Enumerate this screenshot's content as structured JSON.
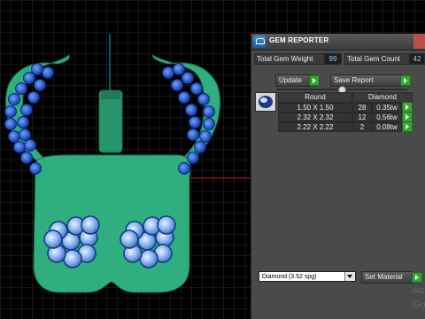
{
  "panel": {
    "title": "GEM REPORTER",
    "total_gem_weight_label": "Total Gem Weight",
    "total_gem_weight_value": "99",
    "total_gem_count_label": "Total Gem Count",
    "total_gem_count_value": "42",
    "update_label": "Update",
    "save_report_label": "Save Report",
    "table": {
      "headers": [
        "Round",
        "Diamond"
      ],
      "rows": [
        {
          "size": "1.50 X 1.50",
          "count": "28",
          "weight": "0.35tw"
        },
        {
          "size": "2.32 X 2.32",
          "count": "12",
          "weight": "0.56tw"
        },
        {
          "size": "2.22 X 2.22",
          "count": "2",
          "weight": "0.08tw"
        }
      ]
    },
    "material_select": "Diamond    (3.52 spg)",
    "set_material_label": "Set Material"
  },
  "watermark": {
    "line1": "Ac",
    "line2": "Go"
  },
  "colors": {
    "grid_bg": "#000000",
    "model_green": "#2fae7f",
    "gem_blue": "#1d4fd0",
    "panel_bg": "#4a4a4a"
  }
}
